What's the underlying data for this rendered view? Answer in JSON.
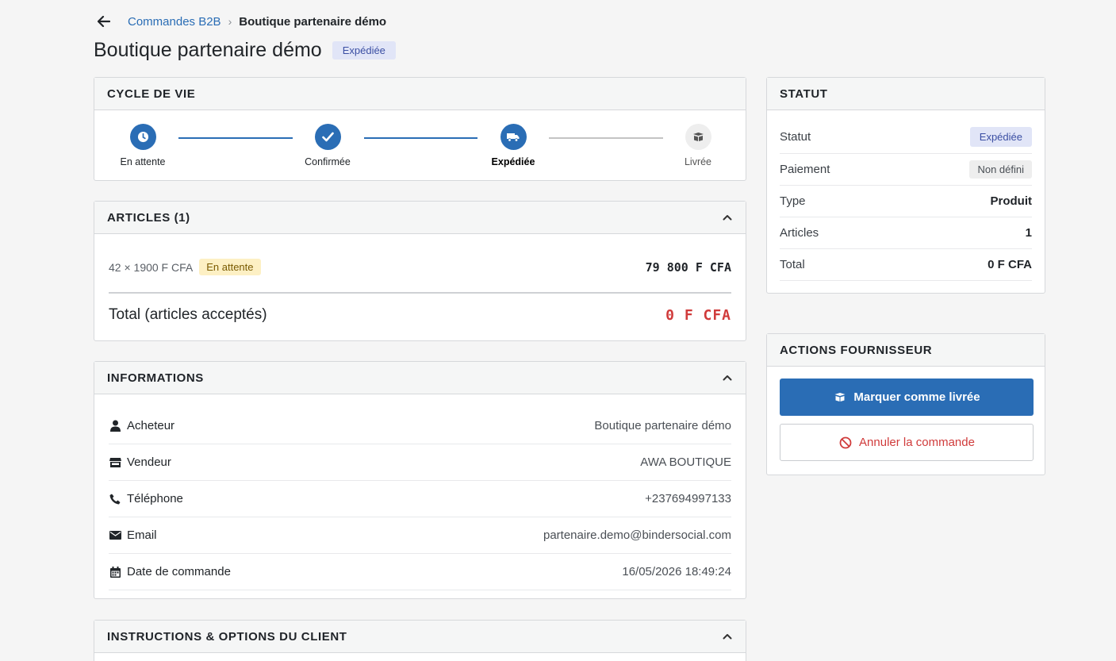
{
  "breadcrumb": {
    "parent": "Commandes B2B",
    "separator": "›",
    "current": "Boutique partenaire démo"
  },
  "title": "Boutique partenaire démo",
  "status_badge": "Expédiée",
  "lifecycle": {
    "header": "CYCLE DE VIE",
    "steps": [
      {
        "label": "En attente",
        "icon": "clock-icon",
        "state": "done"
      },
      {
        "label": "Confirmée",
        "icon": "check-icon",
        "state": "done"
      },
      {
        "label": "Expédiée",
        "icon": "truck-icon",
        "state": "current"
      },
      {
        "label": "Livrée",
        "icon": "box-icon",
        "state": "pending"
      }
    ]
  },
  "articles": {
    "header": "ARTICLES (1)",
    "items": [
      {
        "qty_price": "42 × 1900 F CFA",
        "status": "En attente",
        "amount": "79 800 F CFA"
      }
    ],
    "total_label": "Total (articles acceptés)",
    "total_value": "0 F CFA"
  },
  "informations": {
    "header": "INFORMATIONS",
    "rows": [
      {
        "icon": "user-icon",
        "label": "Acheteur",
        "value": "Boutique partenaire démo"
      },
      {
        "icon": "store-icon",
        "label": "Vendeur",
        "value": "AWA BOUTIQUE"
      },
      {
        "icon": "phone-icon",
        "label": "Téléphone",
        "value": "+237694997133"
      },
      {
        "icon": "envelope-icon",
        "label": "Email",
        "value": "partenaire.demo@bindersocial.com"
      },
      {
        "icon": "calendar-icon",
        "label": "Date de commande",
        "value": "16/05/2026 18:49:24"
      }
    ]
  },
  "instructions": {
    "header": "INSTRUCTIONS & OPTIONS DU CLIENT"
  },
  "statut": {
    "header": "STATUT",
    "rows": [
      {
        "label": "Statut",
        "value": "Expédiée"
      },
      {
        "label": "Paiement",
        "value": "Non défini"
      },
      {
        "label": "Type",
        "value": "Produit"
      },
      {
        "label": "Articles",
        "value": "1"
      },
      {
        "label": "Total",
        "value": "0 F CFA"
      }
    ]
  },
  "actions": {
    "header": "ACTIONS FOURNISSEUR",
    "deliver_label": "Marquer comme livrée",
    "cancel_label": "Annuler la commande"
  },
  "colors": {
    "primary": "#2a6db5",
    "danger": "#d03b3b",
    "pending_badge_bg": "#fdf0c4",
    "shipped_badge_bg": "#e1e5f7"
  }
}
